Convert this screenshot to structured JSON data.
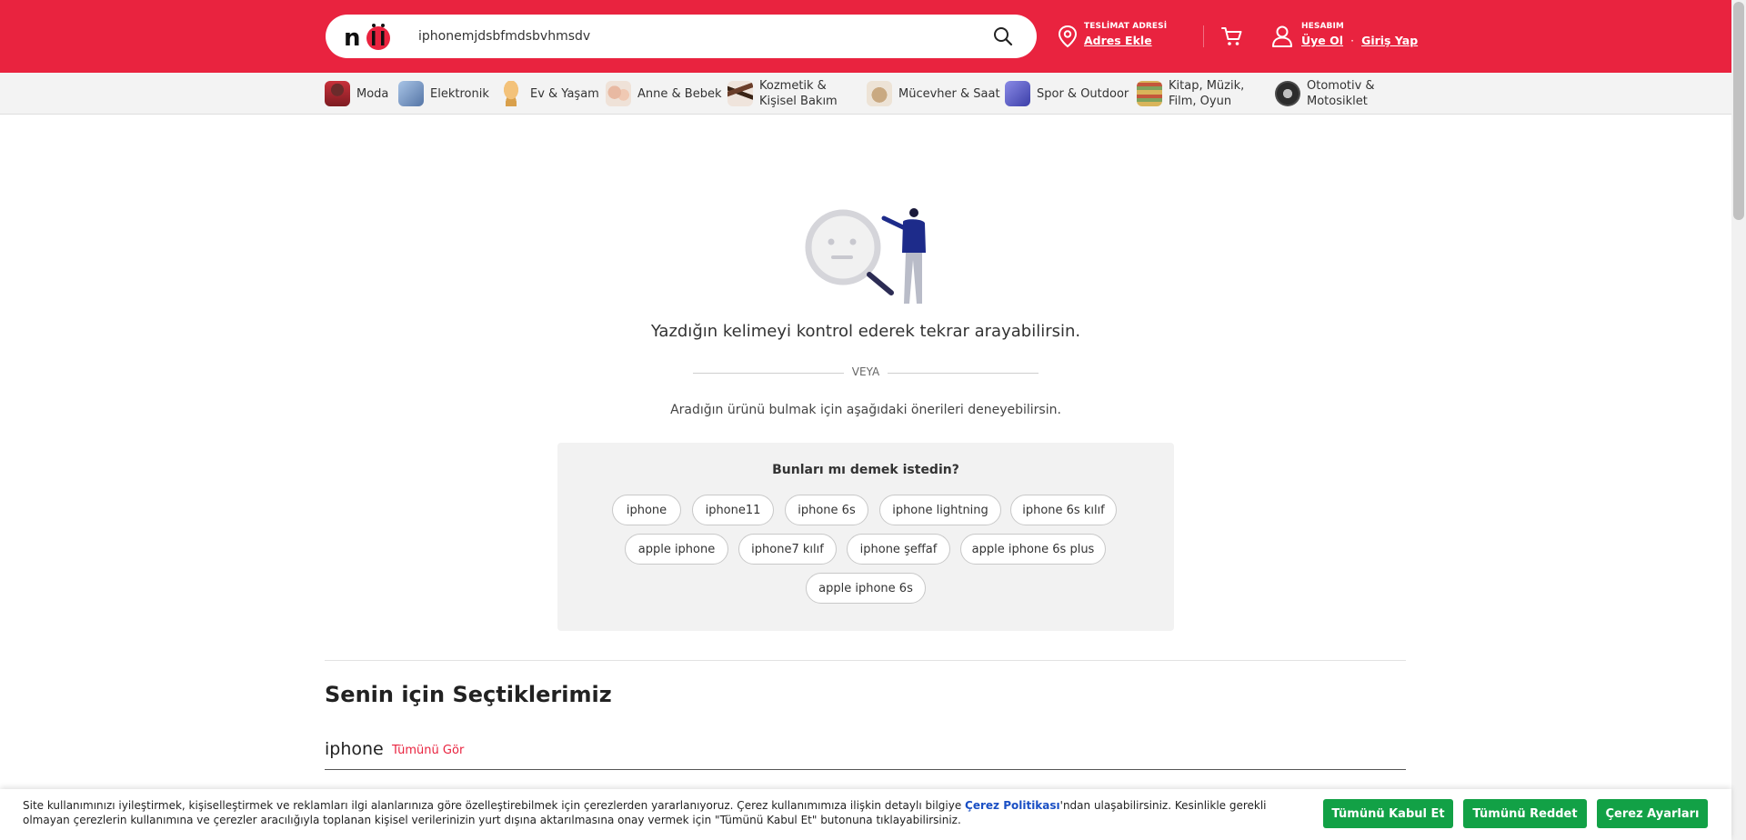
{
  "header": {
    "logo_text": "n11",
    "search_value": "iphonemjdsbfmdsbvhmsdv",
    "delivery_label": "TESLİMAT ADRESİ",
    "delivery_link": "Adres Ekle",
    "account_label": "HESABIM",
    "signup_link": "Üye Ol",
    "separator": "·",
    "login_link": "Giriş Yap"
  },
  "categories": [
    {
      "label": "Moda"
    },
    {
      "label": "Elektronik"
    },
    {
      "label": "Ev & Yaşam"
    },
    {
      "label": "Anne & Bebek"
    },
    {
      "label": "Kozmetik &\nKişisel Bakım"
    },
    {
      "label": "Mücevher & Saat"
    },
    {
      "label": "Spor & Outdoor"
    },
    {
      "label": "Kitap, Müzik,\nFilm, Oyun"
    },
    {
      "label": "Otomotiv &\nMotosiklet"
    }
  ],
  "empty": {
    "message": "Yazdığın kelimeyi kontrol ederek tekrar arayabilirsin.",
    "or": "VEYA",
    "sub": "Aradığın ürünü bulmak için aşağıdaki önerileri deneyebilirsin."
  },
  "suggestions": {
    "title": "Bunları mı demek istedin?",
    "items": [
      "iphone",
      "iphone11",
      "iphone 6s",
      "iphone lightning",
      "iphone 6s kılıf",
      "apple iphone",
      "iphone7 kılıf",
      "iphone şeffaf",
      "apple iphone 6s plus",
      "apple iphone 6s"
    ]
  },
  "picks": {
    "title": "Senin için Seçtiklerimiz",
    "subtitle": "iphone",
    "see_all": "Tümünü Gör"
  },
  "cookie": {
    "text_before": "Site kullanımınızı iyileştirmek, kişiselleştirmek ve reklamları ilgi alanlarınıza göre özelleştirebilmek için çerezlerden yararlanıyoruz. Çerez kullanımımıza ilişkin detaylı bilgiye ",
    "link": "Çerez Politikası",
    "text_after": "'ndan ulaşabilirsiniz. Kesinlikle gerekli olmayan çerezlerin kullanımına ve çerezler aracılığıyla toplanan kişisel verilerinizin yurt dışına aktarılmasına onay vermek için \"Tümünü Kabul Et\" butonuna tıklayabilirsiniz.",
    "accept": "Tümünü Kabul Et",
    "reject": "Tümünü Reddet",
    "settings": "Çerez Ayarları"
  },
  "colors": {
    "brand": "#e9233f",
    "cookie_button": "#12a146"
  }
}
